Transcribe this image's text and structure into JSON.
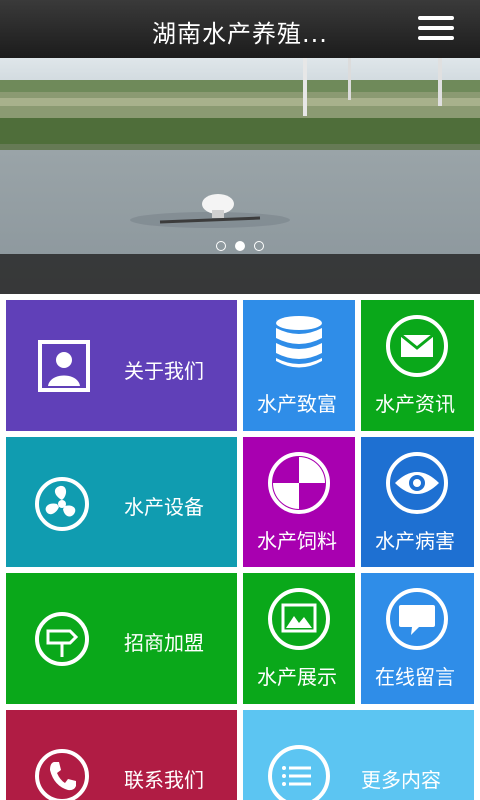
{
  "header": {
    "title": "湖南水产养殖..."
  },
  "banner": {
    "slide_count": 3,
    "active_slide": 2
  },
  "tiles": [
    {
      "id": "about",
      "label": "关于我们",
      "color": "#6040b8",
      "icon": "person-photo-icon"
    },
    {
      "id": "rich",
      "label": "水产致富",
      "color": "#2f8de8",
      "icon": "database-icon"
    },
    {
      "id": "news",
      "label": "水产资讯",
      "color": "#0aa81a",
      "icon": "envelope-icon"
    },
    {
      "id": "equip",
      "label": "水产设备",
      "color": "#109cb0",
      "icon": "fan-icon"
    },
    {
      "id": "feed",
      "label": "水产饲料",
      "color": "#a800b0",
      "icon": "pie-icon"
    },
    {
      "id": "disease",
      "label": "水产病害",
      "color": "#1e70d2",
      "icon": "eye-icon"
    },
    {
      "id": "join",
      "label": "招商加盟",
      "color": "#0aa81a",
      "icon": "signpost-icon"
    },
    {
      "id": "show",
      "label": "水产展示",
      "color": "#0aa81a",
      "icon": "picture-icon"
    },
    {
      "id": "message",
      "label": "在线留言",
      "color": "#2f8de8",
      "icon": "chat-bubble-icon"
    },
    {
      "id": "contact",
      "label": "联系我们",
      "color": "#b01c44",
      "icon": "phone-icon"
    },
    {
      "id": "more",
      "label": "更多内容",
      "color": "#5cc5f2",
      "icon": "list-icon"
    }
  ]
}
